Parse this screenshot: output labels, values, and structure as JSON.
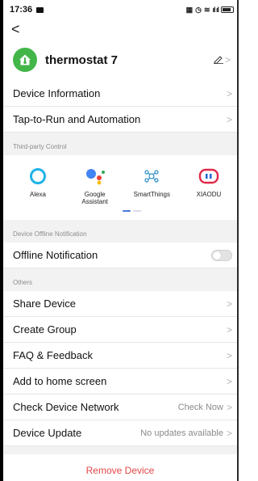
{
  "status_bar": {
    "time": "17:36",
    "icons": [
      "nfc-icon",
      "alarm-icon",
      "wifi-icon",
      "signal-icon",
      "signal-icon",
      "battery-icon"
    ],
    "signal_text": "ıl ıl"
  },
  "nav": {
    "back_glyph": "<"
  },
  "device": {
    "name": "thermostat 7",
    "icon_color": "#43b649",
    "edit_chevron": ">"
  },
  "menu_top": [
    {
      "label": "Device Information",
      "chevron": ">"
    },
    {
      "label": "Tap-to-Run and Automation",
      "chevron": ">"
    }
  ],
  "third_party": {
    "section_title": "Third-party Control",
    "items": [
      {
        "name": "Alexa",
        "icon": "alexa-icon"
      },
      {
        "name": "Google Assistant",
        "icon": "google-assistant-icon"
      },
      {
        "name": "SmartThings",
        "icon": "smartthings-icon"
      },
      {
        "name": "XIAODU",
        "icon": "xiaodu-icon"
      }
    ],
    "page_indicator": {
      "pages": 2,
      "active": 1
    }
  },
  "offline": {
    "section_title": "Device Offline Notification",
    "label": "Offline Notification",
    "enabled": false
  },
  "others": {
    "section_title": "Others",
    "items": [
      {
        "label": "Share Device",
        "value": "",
        "chevron": ">"
      },
      {
        "label": "Create Group",
        "value": "",
        "chevron": ">"
      },
      {
        "label": "FAQ & Feedback",
        "value": "",
        "chevron": ">"
      },
      {
        "label": "Add to home screen",
        "value": "",
        "chevron": ">"
      },
      {
        "label": "Check Device Network",
        "value": "Check Now",
        "chevron": ">"
      },
      {
        "label": "Device Update",
        "value": "No updates available",
        "chevron": ">"
      }
    ]
  },
  "remove_label": "Remove Device",
  "colors": {
    "accent_green": "#43b649",
    "danger_red": "#e34747",
    "indicator_blue": "#4a78d8"
  }
}
